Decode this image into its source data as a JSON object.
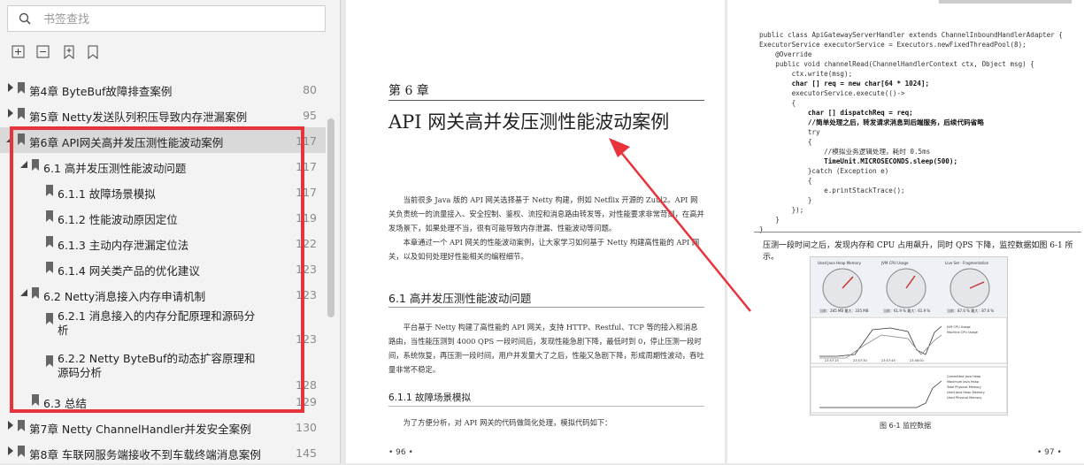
{
  "search": {
    "placeholder": "书签查找"
  },
  "toolbar": {
    "icons": [
      "expand-all-icon",
      "collapse-all-icon",
      "add-bookmark-icon",
      "bookmark-icon"
    ]
  },
  "bookmarks": [
    {
      "label": "第4章 ByteBuf故障排查案例",
      "page": "80"
    },
    {
      "label": "第5章 Netty发送队列积压导致内存泄漏案例",
      "page": "95"
    },
    {
      "label": "第6章 API网关高并发压测性能波动案例",
      "page": "117"
    },
    {
      "label": "6.1 高并发压测性能波动问题",
      "page": "117"
    },
    {
      "label": "6.1.1 故障场景模拟",
      "page": "117"
    },
    {
      "label": "6.1.2 性能波动原因定位",
      "page": "119"
    },
    {
      "label": "6.1.3 主动内存泄漏定位法",
      "page": "122"
    },
    {
      "label": "6.1.4 网关类产品的优化建议",
      "page": "123"
    },
    {
      "label": "6.2 Netty消息接入内存申请机制",
      "page": "123"
    },
    {
      "label": "6.2.1 消息接入的内存分配原理和源码分析",
      "page": "123"
    },
    {
      "label": "6.2.2 Netty ByteBuf的动态扩容原理和源码分析",
      "page": "128"
    },
    {
      "label": "6.3 总结",
      "page": "129"
    },
    {
      "label": "第7章 Netty ChannelHandler并发安全案例",
      "page": "130"
    },
    {
      "label": "第8章 车联网服务端接收不到车载终端消息案例",
      "page": "145"
    }
  ],
  "left_page": {
    "chapter_num": "第 6 章",
    "chapter_title": "API 网关高并发压测性能波动案例",
    "para1": "当前很多 Java 版的 API 网关选择基于 Netty 构建，例如 Netflix 开源的 Zuul2。API 网关负责统一的流量接入、安全控制、鉴权、流控和消息路由转发等，对性能要求非常苛刻，在高并发场景下，如果处理不当，很有可能导致内存泄漏、性能波动等问题。",
    "para2": "本章通过一个 API 网关的性能波动案例，让大家学习如何基于 Netty 构建高性能的 API 网关，以及如何处理好性能相关的编程细节。",
    "section": "6.1 高并发压测性能波动问题",
    "para3": "平台基于 Netty 构建了高性能的 API 网关，支持 HTTP、Restful、TCP 等的接入和消息路由，当性能压测到 4000 QPS 一段时间后，发现性能急剧下降，最低时到 0，停止压测一段时间，系统恢复，再压测一段时间，用户并发量大了之后，性能又急剧下降，形成周期性波动，吞吐量非常不稳定。",
    "subsection": "6.1.1 故障场景模拟",
    "para4": "为了方便分析，对 API 网关的代码做简化处理，模拟代码如下：",
    "page_num": "• 96 •"
  },
  "right_page": {
    "code": [
      "public class ApiGatewayServerHandler extends ChannelInboundHandlerAdapter {",
      "ExecutorService executorService = Executors.newFixedThreadPool(8);",
      "    @Override",
      "    public void channelRead(ChannelHandlerContext ctx, Object msg) {",
      "        ctx.write(msg);",
      "        char [] req = new char[64 * 1024];",
      "        executorService.execute(()->",
      "        {",
      "            char [] dispatchReq = req;",
      "            //简单处理之后，转发请求消息到后端服务，后续代码省略",
      "            try",
      "            {",
      "                //模拟业务逻辑处理，耗时 0.5ms",
      "                TimeUnit.MICROSECONDS.sleep(500);",
      "            }catch (Exception e)",
      "            {",
      "                e.printStackTrace();",
      "            }",
      "        });",
      "    }",
      "}"
    ],
    "bold_lines": [
      5,
      8,
      9,
      13
    ],
    "text": "压测一段时间之后，发现内存和 CPU 占用飙升，同时 QPS 下降，监控数据如图 6-1 所示。",
    "figure_caption": "图 6-1    监控数据",
    "gauges": [
      "Used Java Heap Memory",
      "JVM CPU Usage",
      "Live Set - Fragmentation"
    ],
    "gauge_values": [
      "当前：285 MB  最大：335 MB",
      "当前：61.9 %  最大：61.9 %",
      "当前：87.6 %  最大：87.6 %"
    ],
    "cpu_legend": [
      "JVM CPU Usage",
      "Machine CPU Usage"
    ],
    "cpu_times": [
      "23:57:15",
      "23:57:30",
      "23:57:45",
      "23:58:00"
    ],
    "mem_legend": [
      "Committed Java Heap",
      "Maximum Java Heap",
      "Total Physical Memory",
      "Used Java Heap Memory",
      "Used Physical Memory"
    ],
    "page_num": "• 97 •"
  }
}
